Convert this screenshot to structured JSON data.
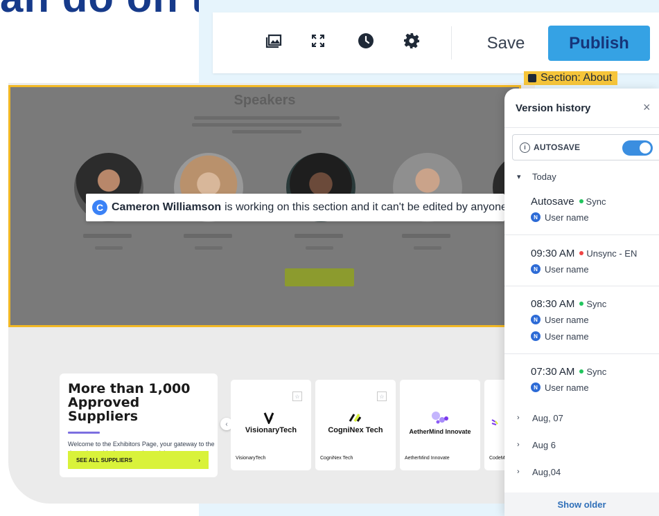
{
  "heading": {
    "text": "an do on th"
  },
  "toolbar": {
    "icons": [
      "image-icon",
      "fullscreen-icon",
      "clock-icon",
      "gear-icon"
    ],
    "save_label": "Save",
    "publish_label": "Publish"
  },
  "section": {
    "label": "Section: About",
    "title": "Speakers",
    "lock_user_initial": "C",
    "lock_user": "Cameron Williamson",
    "lock_message": "is working on this section and it can't be edited by anyone"
  },
  "suppliers": {
    "title": "More than 1,000 Approved Suppliers",
    "description": "Welcome to the Exhibitors Page, your gateway to the dynamic world of our event's participants.",
    "button_label": "SEE ALL SUPPLIERS",
    "button_arrow": "›",
    "prev_arrow": "‹",
    "star": "☆",
    "cards": [
      {
        "logo_text": "VisionaryTech",
        "name": "VisionaryTech"
      },
      {
        "logo_text": "CogniNex Tech",
        "name": "CogniNex Tech"
      },
      {
        "logo_text": "AetherMind Innovate",
        "name": "AetherMind Innovate"
      },
      {
        "logo_text": "",
        "name": "CodeM"
      }
    ]
  },
  "panel": {
    "title": "Version history",
    "close": "×",
    "autosave_label": "AUTOSAVE",
    "autosave_on": true,
    "info": "i",
    "today_label": "Today",
    "entries": [
      {
        "time": "Autosave",
        "status": "Sync",
        "status_color": "#22c55e",
        "users": [
          "User name"
        ]
      },
      {
        "time": "09:30 AM",
        "status": "Unsync - EN",
        "status_color": "#ef4444",
        "users": [
          "User name"
        ]
      },
      {
        "time": "08:30 AM",
        "status": "Sync",
        "status_color": "#22c55e",
        "users": [
          "User name",
          "User name"
        ]
      },
      {
        "time": "07:30 AM",
        "status": "Sync",
        "status_color": "#22c55e",
        "users": [
          "User name"
        ]
      }
    ],
    "user_initial": "N",
    "collapsed_groups": [
      "Aug, 07",
      "Aug 6",
      "Aug,04"
    ],
    "show_older_label": "Show older"
  },
  "colors": {
    "publish_bg": "#35a2e4",
    "section_border": "#f2b824",
    "suppliers_button": "#d9f23a",
    "toggle_on": "#3b8ee0"
  }
}
